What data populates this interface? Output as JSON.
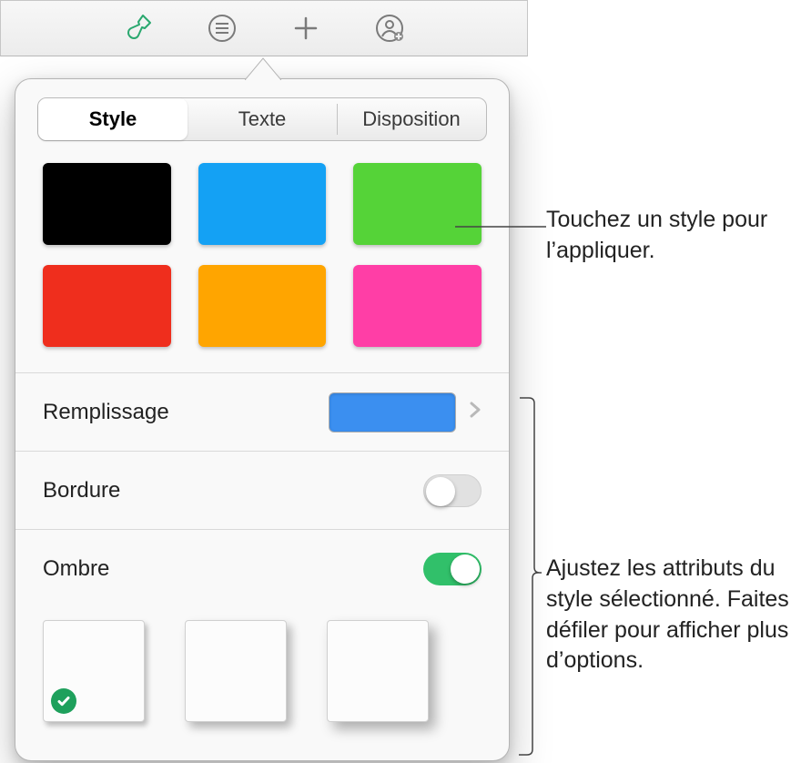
{
  "toolbar": {
    "icons": [
      "format-brush-icon",
      "list-icon",
      "plus-icon",
      "collaborate-icon"
    ],
    "active_index": 0
  },
  "popover": {
    "tabs": [
      "Style",
      "Texte",
      "Disposition"
    ],
    "selected_tab": 0
  },
  "style_swatches": [
    {
      "name": "black",
      "color": "#000000"
    },
    {
      "name": "blue",
      "color": "#14a1f4"
    },
    {
      "name": "green",
      "color": "#55d338"
    },
    {
      "name": "red",
      "color": "#ef2e1d"
    },
    {
      "name": "orange",
      "color": "#ffa500"
    },
    {
      "name": "magenta",
      "color": "#ff3ea6"
    }
  ],
  "rows": {
    "fill": {
      "label": "Remplissage",
      "value_color": "#3b8ff0"
    },
    "border": {
      "label": "Bordure",
      "on": false
    },
    "shadow": {
      "label": "Ombre",
      "on": true,
      "selected": 0
    }
  },
  "callouts": {
    "apply_style": "Touchez un style pour l’appliquer.",
    "adjust_attrs": "Ajustez les attributs du style sélectionné. Faites défiler pour afficher plus d’options."
  }
}
